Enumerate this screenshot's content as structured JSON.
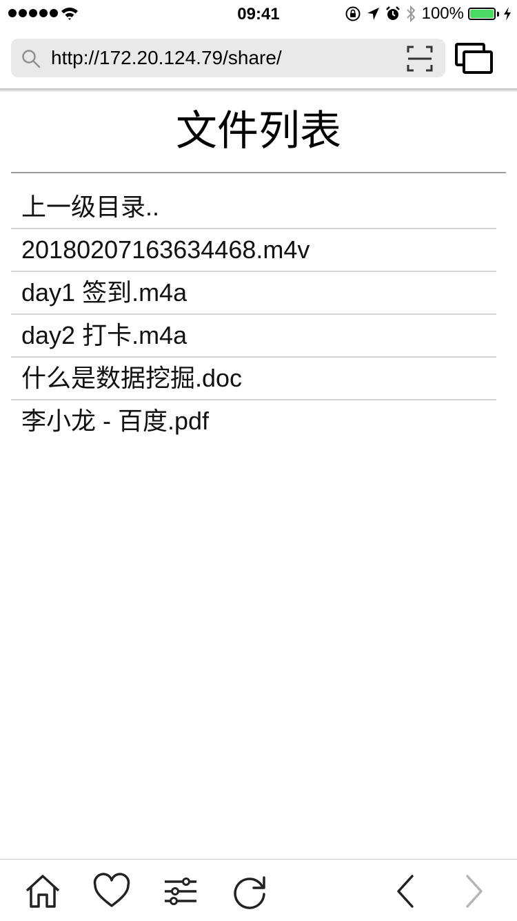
{
  "status_bar": {
    "time": "09:41",
    "battery_percent": "100%",
    "battery_level": 1.0,
    "signal_bars": 5,
    "battery_color": "#4cd964"
  },
  "address_bar": {
    "url": "http://172.20.124.79/share/",
    "search_icon": "search-icon",
    "scan_icon": "scan-icon"
  },
  "toolbar_top": {
    "tabs_icon": "tabs-icon"
  },
  "page": {
    "title": "文件列表",
    "files": [
      "上一级目录..",
      "20180207163634468.m4v",
      "day1 签到.m4a",
      "day2 打卡.m4a",
      "什么是数据挖掘.doc",
      "李小龙 - 百度.pdf"
    ]
  },
  "bottom_bar": {
    "icons": [
      "home-icon",
      "heart-icon",
      "sliders-icon",
      "refresh-icon",
      "back-icon",
      "forward-icon"
    ],
    "forward_disabled_color": "#b5b5b5"
  }
}
